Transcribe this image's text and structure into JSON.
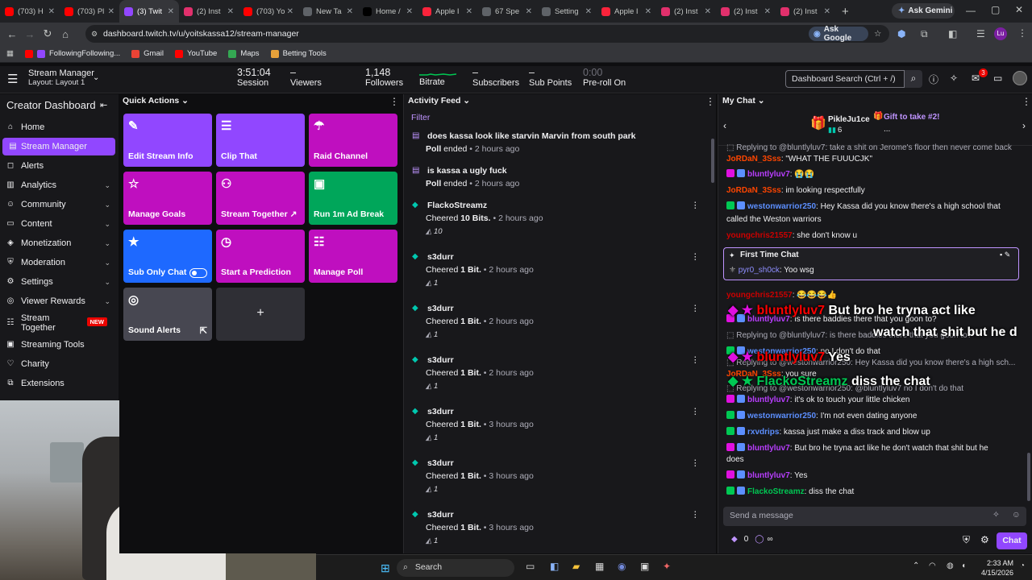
{
  "browser": {
    "tabs": [
      {
        "label": "(703) H",
        "color": "#ff0000"
      },
      {
        "label": "(703) Pl",
        "color": "#ff0000"
      },
      {
        "label": "(3) Twit",
        "color": "#9147ff"
      },
      {
        "label": "(2) Inst",
        "color": "#e1306c"
      },
      {
        "label": "(703) Yo",
        "color": "#ff0000"
      },
      {
        "label": "New Ta",
        "color": "#5f6368"
      },
      {
        "label": "Home /",
        "color": "#000000"
      },
      {
        "label": "Apple I",
        "color": "#fa233b"
      },
      {
        "label": "67 Spe",
        "color": "#5f6368"
      },
      {
        "label": "Setting",
        "color": "#5f6368"
      },
      {
        "label": "Apple I",
        "color": "#fa233b"
      },
      {
        "label": "(2) Inst",
        "color": "#e1306c"
      },
      {
        "label": "(2) Inst",
        "color": "#e1306c"
      },
      {
        "label": "(2) Inst",
        "color": "#e1306c"
      }
    ],
    "new_tab": "+",
    "ask_gemini": "Ask Gemini",
    "url": "dashboard.twitch.tv/u/yoitskassa12/stream-manager",
    "ask_google": "Ask Google",
    "profile_initials": "Lu",
    "bookmarks": [
      "FollowingFollowing...",
      "Gmail",
      "YouTube",
      "Maps",
      "Betting Tools"
    ]
  },
  "topbar": {
    "title": "Stream Manager",
    "layout": "Layout: Layout 1",
    "stats": [
      {
        "value": "3:51:04",
        "label": "Session"
      },
      {
        "value": "–",
        "label": "Viewers"
      },
      {
        "value": "1,148",
        "label": "Followers"
      },
      {
        "value": "",
        "label": "Bitrate"
      },
      {
        "value": "–",
        "label": "Subscribers"
      },
      {
        "value": "–",
        "label": "Sub Points"
      },
      {
        "value": "0:00",
        "label": "Pre-roll On"
      }
    ],
    "search_placeholder": "Dashboard Search (Ctrl + /)",
    "notif_count": "3"
  },
  "sidebar": {
    "title": "Creator Dashboard",
    "items": [
      {
        "label": "Home",
        "icon": "home-icon",
        "chev": false
      },
      {
        "label": "Stream Manager",
        "icon": "stream-manager-icon",
        "chev": false,
        "selected": true
      },
      {
        "label": "Alerts",
        "icon": "alerts-icon",
        "chev": false
      },
      {
        "label": "Analytics",
        "icon": "analytics-icon",
        "chev": true
      },
      {
        "label": "Community",
        "icon": "community-icon",
        "chev": true
      },
      {
        "label": "Content",
        "icon": "content-icon",
        "chev": true
      },
      {
        "label": "Monetization",
        "icon": "monetization-icon",
        "chev": true
      },
      {
        "label": "Moderation",
        "icon": "moderation-icon",
        "chev": true
      },
      {
        "label": "Settings",
        "icon": "settings-icon",
        "chev": true
      },
      {
        "label": "Viewer Rewards",
        "icon": "rewards-icon",
        "chev": true
      },
      {
        "label": "Stream\nTogether",
        "icon": "stream-together-icon",
        "chev": false,
        "badge": "NEW"
      },
      {
        "label": "Streaming Tools",
        "icon": "tools-icon",
        "chev": false
      },
      {
        "label": "Charity",
        "icon": "charity-icon",
        "chev": false
      },
      {
        "label": "Extensions",
        "icon": "extensions-icon",
        "chev": false
      }
    ]
  },
  "quick_actions": {
    "title": "Quick Actions",
    "tiles": [
      {
        "label": "Edit Stream Info",
        "color": "#9147ff",
        "icon": "✎"
      },
      {
        "label": "Clip That",
        "color": "#9147ff",
        "icon": "☰"
      },
      {
        "label": "Raid Channel",
        "color": "#bf0fbf",
        "icon": "☂"
      },
      {
        "label": "Manage Goals",
        "color": "#bf0fbf",
        "icon": "☆"
      },
      {
        "label": "Stream Together ↗",
        "color": "#bf0fbf",
        "icon": "⚇"
      },
      {
        "label": "Run 1m Ad Break",
        "color": "#00a65a",
        "icon": "▣"
      },
      {
        "label": "Sub Only Chat",
        "color": "#1e69ff",
        "icon": "★"
      },
      {
        "label": "Start a Prediction",
        "color": "#bf0fbf",
        "icon": "◷"
      },
      {
        "label": "Manage Poll",
        "color": "#bf0fbf",
        "icon": "☷"
      },
      {
        "label": "Sound Alerts",
        "color": "#474751",
        "icon": "◎"
      }
    ],
    "add": "+"
  },
  "activity": {
    "title": "Activity Feed",
    "filter": "Filter",
    "events": [
      {
        "title": "does kassa look like starvin Marvin from south park",
        "action": "Poll",
        "rest": " ended",
        "time": "2 hours ago",
        "type": "poll"
      },
      {
        "title": "is kassa a ugly fuck",
        "action": "Poll",
        "rest": " ended",
        "time": "2 hours ago",
        "type": "poll"
      },
      {
        "title": "FlackoStreamz",
        "action": "Cheered ",
        "amount": "10 Bits.",
        "time": "2 hours ago",
        "type": "cheer",
        "qty": "10"
      },
      {
        "title": "s3durr",
        "action": "Cheered ",
        "amount": "1 Bit.",
        "time": "2 hours ago",
        "type": "cheer",
        "qty": "1"
      },
      {
        "title": "s3durr",
        "action": "Cheered ",
        "amount": "1 Bit.",
        "time": "2 hours ago",
        "type": "cheer",
        "qty": "1"
      },
      {
        "title": "s3durr",
        "action": "Cheered ",
        "amount": "1 Bit.",
        "time": "2 hours ago",
        "type": "cheer",
        "qty": "1"
      },
      {
        "title": "s3durr",
        "action": "Cheered ",
        "amount": "1 Bit.",
        "time": "3 hours ago",
        "type": "cheer",
        "qty": "1"
      },
      {
        "title": "s3durr",
        "action": "Cheered ",
        "amount": "1 Bit.",
        "time": "3 hours ago",
        "type": "cheer",
        "qty": "1"
      },
      {
        "title": "s3durr",
        "action": "Cheered ",
        "amount": "1 Bit.",
        "time": "3 hours ago",
        "type": "cheer",
        "qty": "1"
      }
    ]
  },
  "chat": {
    "title": "My Chat",
    "pinned_user": "PikleJu1ce",
    "pinned_count": "6",
    "gift_text": "Gift to take #2!",
    "gift_sub": "...",
    "first_time_label": "First Time Chat",
    "first_time_user": "pyr0_sh0ck",
    "first_time_msg": ": Yoo wsg",
    "overlay_lines": [
      {
        "user": "bluntlyluv7",
        "msg": "But bro he tryna act like",
        "color": "#ff0000"
      },
      {
        "user": "",
        "msg": "watch that shit but he d",
        "color": "#ff0000"
      },
      {
        "user": "bluntlyluv7",
        "msg": "Yes",
        "color": "#ff0000"
      },
      {
        "user": "FlackoStreamz",
        "msg": "diss the chat",
        "color": "#00c853"
      }
    ],
    "messages": [
      {
        "user": "",
        "msg": "Replying to @bluntlyluv7: take a shit on Jerome's floor then never come back",
        "color": "#adadb8",
        "reply": true
      },
      {
        "user": "JoRDaN_3Sss",
        "msg": ": \"WHAT THE FUUUCJK\"",
        "color": "#ff4500"
      },
      {
        "user": "bluntlyluv7",
        "msg": ": 😭😭",
        "color": "#b93eff",
        "badges": true
      },
      {
        "user": "JoRDaN_3Sss",
        "msg": ": im looking respectfully",
        "color": "#ff4500"
      },
      {
        "user": "westonwarrior250",
        "msg": ": Hey Kassa did you know there's a high school that",
        "color": "#5c8fff",
        "badges": true
      },
      {
        "user": "",
        "msg": "called the Weston warriors",
        "color": "#efeff1"
      },
      {
        "user": "youngchris21557",
        "msg": ": she don't know u",
        "color": "#cc0000"
      },
      {
        "user": "youngchris21557",
        "msg": ": 😂😂😂👍",
        "color": "#cc0000"
      },
      {
        "user": "bluntlyluv7",
        "msg": ": is there baddies there that you goon to?",
        "color": "#b93eff",
        "badges": true
      },
      {
        "user": "",
        "msg": "Replying to @bluntlyluv7: is there baddies there that you goon to?",
        "color": "#adadb8",
        "reply": true
      },
      {
        "user": "westonwarrior250",
        "msg": ": no I don't do that",
        "color": "#5c8fff",
        "badges": true
      },
      {
        "user": "",
        "msg": "Replying to @westonwarrior250: Hey Kassa did you know there's a high sch...",
        "color": "#adadb8",
        "reply": true
      },
      {
        "user": "JoRDaN_3Sss",
        "msg": ": you sure",
        "color": "#ff4500"
      },
      {
        "user": "",
        "msg": "Replying to @westonwarrior250: @bluntlyluv7 no I don't do that",
        "color": "#adadb8",
        "reply": true
      },
      {
        "user": "bluntlyluv7",
        "msg": ": it's ok to touch your little chicken",
        "color": "#b93eff",
        "badges": true
      },
      {
        "user": "westonwarrior250",
        "msg": ": I'm not even dating anyone",
        "color": "#5c8fff",
        "badges": true
      },
      {
        "user": "rxvdrips",
        "msg": ": kassa just make a diss track and blow up",
        "color": "#5c8fff",
        "badges": true
      },
      {
        "user": "bluntlyluv7",
        "msg": ": But bro he tryna act like he don't watch that shit but he",
        "color": "#b93eff",
        "badges": true
      },
      {
        "user": "",
        "msg": "does",
        "color": "#efeff1"
      },
      {
        "user": "bluntlyluv7",
        "msg": ": Yes",
        "color": "#b93eff",
        "badges": true
      },
      {
        "user": "FlackoStreamz",
        "msg": ": diss the chat",
        "color": "#00c853",
        "badges": true
      }
    ],
    "input_placeholder": "Send a message",
    "points": "0",
    "points2": "∞",
    "chat_button": "Chat"
  },
  "taskbar": {
    "search": "Search",
    "time": "2:33 AM",
    "date": "4/15/2026"
  }
}
